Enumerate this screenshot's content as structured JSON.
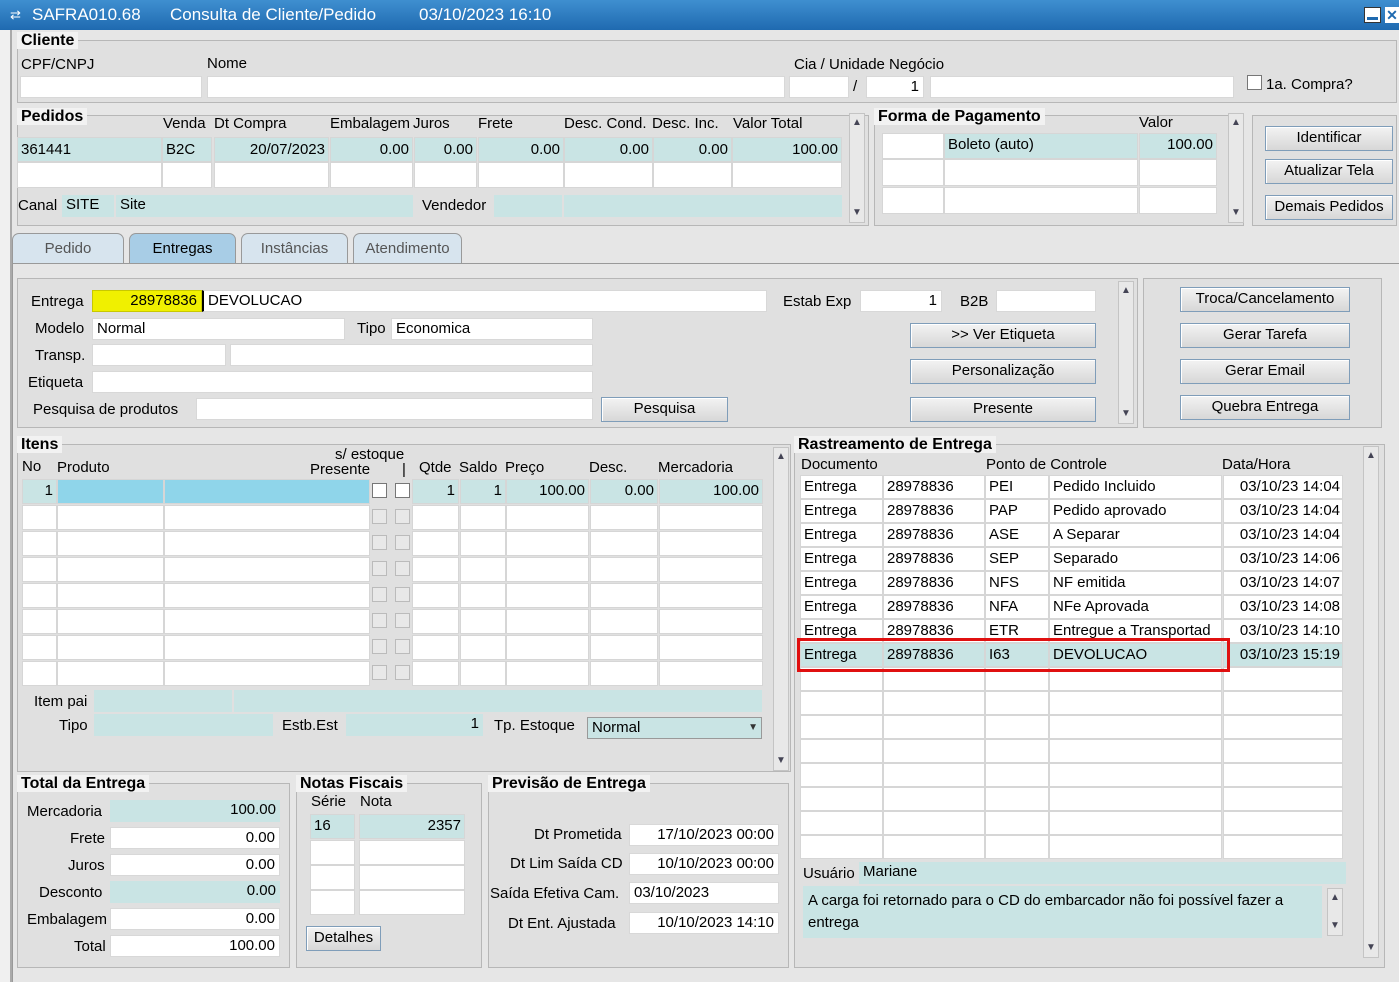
{
  "window": {
    "code": "SAFRA010.68",
    "title": "Consulta de Cliente/Pedido",
    "datetime": "03/10/2023 16:10"
  },
  "cliente": {
    "title": "Cliente",
    "cpf_label": "CPF/CNPJ",
    "cpf": "",
    "nome_label": "Nome",
    "nome": "",
    "cia_label": "Cia / Unidade Negócio",
    "cia": "",
    "sep": "/",
    "unidade": "1",
    "primeira_compra": "1a. Compra?"
  },
  "pedidos": {
    "title": "Pedidos",
    "headers": [
      "Venda",
      "Dt Compra",
      "Embalagem",
      "Juros",
      "Frete",
      "Desc. Cond.",
      "Desc. Inc.",
      "Valor Total"
    ],
    "row": {
      "pedido": "361441",
      "venda": "B2C",
      "dt_compra": "20/07/2023",
      "embalagem": "0.00",
      "juros": "0.00",
      "frete": "0.00",
      "desc_cond": "0.00",
      "desc_inc": "0.00",
      "valor_total": "100.00"
    },
    "canal_label": "Canal",
    "canal_code": "SITE",
    "canal_name": "Site",
    "vendedor_label": "Vendedor",
    "vendedor": ""
  },
  "pagamento": {
    "title": "Forma de Pagamento",
    "valor_label": "Valor",
    "forma": "Boleto (auto)",
    "valor": "100.00"
  },
  "side_buttons": {
    "identificar": "Identificar",
    "atualizar": "Atualizar Tela",
    "demais": "Demais Pedidos"
  },
  "tabs": [
    "Pedido",
    "Entregas",
    "Instâncias",
    "Atendimento"
  ],
  "entrega": {
    "label": "Entrega",
    "numero": "28978836",
    "status": "DEVOLUCAO",
    "estab_label": "Estab Exp",
    "estab": "1",
    "b2b_label": "B2B",
    "b2b": "",
    "modelo_label": "Modelo",
    "modelo": "Normal",
    "tipo_label": "Tipo",
    "tipo": "Economica",
    "transp_label": "Transp.",
    "transp_code": "",
    "transp_name": "",
    "etiqueta_label": "Etiqueta",
    "etiqueta": "",
    "pesquisa_label": "Pesquisa de produtos",
    "pesquisa": "",
    "buttons": {
      "pesquisa": "Pesquisa",
      "ver_etiqueta": ">> Ver Etiqueta",
      "personalizacao": "Personalização",
      "presente": "Presente",
      "troca": "Troca/Cancelamento",
      "tarefa": "Gerar Tarefa",
      "email": "Gerar Email",
      "quebra": "Quebra Entrega"
    }
  },
  "itens": {
    "title": "Itens",
    "headers": {
      "no": "No",
      "produto": "Produto",
      "estoque": "s/ estoque",
      "presente": "Presente",
      "bar": "|",
      "qtde": "Qtde",
      "saldo": "Saldo",
      "preco": "Preço",
      "desc": "Desc.",
      "mercadoria": "Mercadoria"
    },
    "row": {
      "no": "1",
      "produto_code": "",
      "produto_desc": "",
      "qtde": "1",
      "saldo": "1",
      "preco": "100.00",
      "desc": "0.00",
      "mercadoria": "100.00"
    },
    "item_pai_label": "Item pai",
    "tipo_label": "Tipo",
    "estb_label": "Estb.Est",
    "estb": "1",
    "tp_estoque_label": "Tp. Estoque",
    "tp_estoque": "Normal"
  },
  "rastreamento": {
    "title": "Rastreamento de Entrega",
    "headers": [
      "Documento",
      "Ponto de Controle",
      "Data/Hora"
    ],
    "rows": [
      {
        "doc": "Entrega",
        "num": "28978836",
        "code": "PEI",
        "desc": "Pedido Incluido",
        "data": "03/10/23 14:04"
      },
      {
        "doc": "Entrega",
        "num": "28978836",
        "code": "PAP",
        "desc": "Pedido aprovado",
        "data": "03/10/23 14:04"
      },
      {
        "doc": "Entrega",
        "num": "28978836",
        "code": "ASE",
        "desc": "A Separar",
        "data": "03/10/23 14:04"
      },
      {
        "doc": "Entrega",
        "num": "28978836",
        "code": "SEP",
        "desc": "Separado",
        "data": "03/10/23 14:06"
      },
      {
        "doc": "Entrega",
        "num": "28978836",
        "code": "NFS",
        "desc": "NF emitida",
        "data": "03/10/23 14:07"
      },
      {
        "doc": "Entrega",
        "num": "28978836",
        "code": "NFA",
        "desc": "NFe Aprovada",
        "data": "03/10/23 14:08"
      },
      {
        "doc": "Entrega",
        "num": "28978836",
        "code": "ETR",
        "desc": "Entregue a Transportad",
        "data": "03/10/23 14:10"
      },
      {
        "doc": "Entrega",
        "num": "28978836",
        "code": "I63",
        "desc": "DEVOLUCAO",
        "data": "03/10/23 15:19"
      }
    ],
    "usuario_label": "Usuário",
    "usuario": "Mariane",
    "obs": "A carga foi retornado para o CD do embarcador não foi possível fazer a entrega"
  },
  "total": {
    "title": "Total da Entrega",
    "mercadoria_label": "Mercadoria",
    "mercadoria": "100.00",
    "frete_label": "Frete",
    "frete": "0.00",
    "juros_label": "Juros",
    "juros": "0.00",
    "desconto_label": "Desconto",
    "desconto": "0.00",
    "embalagem_label": "Embalagem",
    "embalagem": "0.00",
    "total_label": "Total",
    "total": "100.00"
  },
  "notas": {
    "title": "Notas Fiscais",
    "serie_label": "Série",
    "nota_label": "Nota",
    "serie": "16",
    "nota": "2357",
    "detalhes": "Detalhes"
  },
  "previsao": {
    "title": "Previsão de Entrega",
    "prometida_label": "Dt Prometida",
    "prometida": "17/10/2023 00:00",
    "lim_label": "Dt Lim Saída CD",
    "lim": "10/10/2023 00:00",
    "saida_label": "Saída Efetiva Cam.",
    "saida": "03/10/2023",
    "ajustada_label": "Dt Ent. Ajustada",
    "ajustada": "10/10/2023 14:10"
  },
  "colors": {
    "titlebar": "#1f6ab0",
    "field_teal": "#c9e4e4",
    "highlight_yellow": "#f0f000",
    "selection_box": "#e01010"
  }
}
